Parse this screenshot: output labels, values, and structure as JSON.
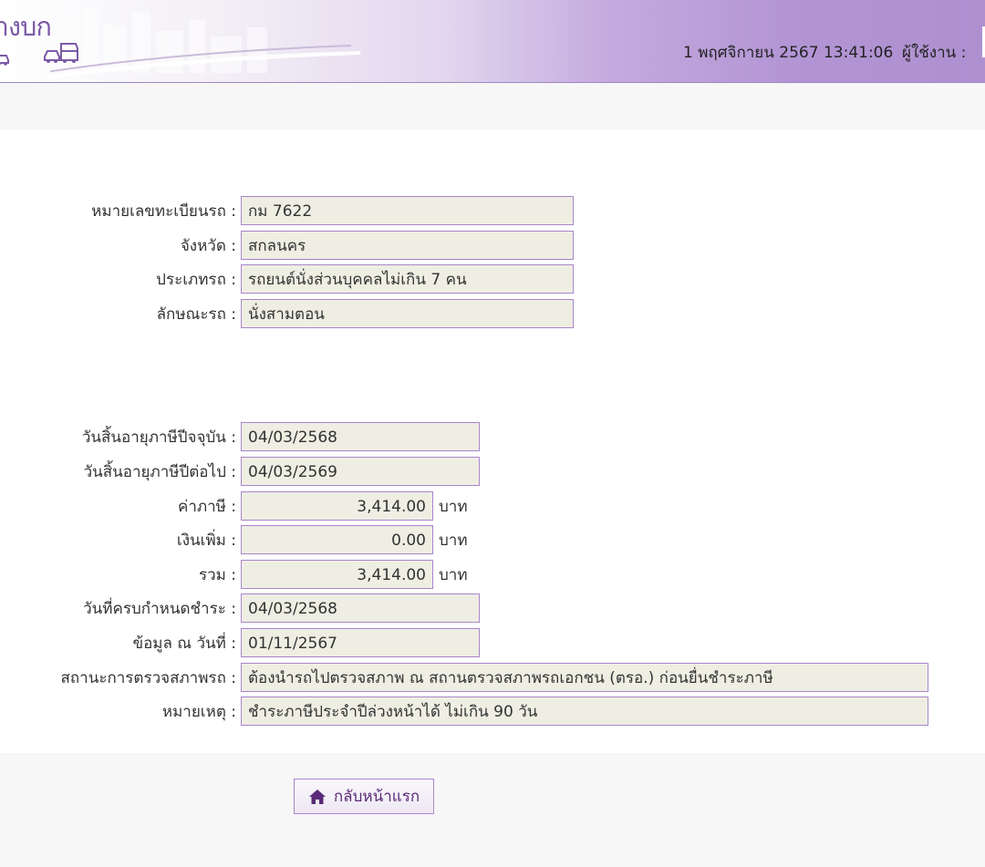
{
  "header": {
    "brand_text": "ขนส่งทางบก",
    "datetime": "1 พฤศจิกายน 2567 13:41:06",
    "user_label": "ผู้ใช้งาน :"
  },
  "vehicle": [
    {
      "label": "หมายเลขทะเบียนรถ :",
      "value": "กม 7622"
    },
    {
      "label": "จังหวัด :",
      "value": "สกลนคร"
    },
    {
      "label": "ประเภทรถ :",
      "value": "รถยนต์นั่งส่วนบุคคลไม่เกิน 7 คน"
    },
    {
      "label": "ลักษณะรถ :",
      "value": "นั่งสามตอน"
    }
  ],
  "tax": {
    "expire_current": {
      "label": "วันสิ้นอายุภาษีปีจจุบัน :",
      "value": "04/03/2568"
    },
    "expire_next": {
      "label": "วันสิ้นอายุภาษีปีต่อไป :",
      "value": "04/03/2569"
    },
    "tax_amount": {
      "label": "ค่าภาษี :",
      "value": "3,414.00",
      "unit": "บาท"
    },
    "surcharge": {
      "label": "เงินเพิ่ม :",
      "value": "0.00",
      "unit": "บาท"
    },
    "total": {
      "label": "รวม :",
      "value": "3,414.00",
      "unit": "บาท"
    },
    "due_date": {
      "label": "วันที่ครบกำหนดชำระ :",
      "value": "04/03/2568"
    },
    "data_as_of": {
      "label": "ข้อมูล ณ วันที่ :",
      "value": "01/11/2567"
    },
    "inspection_status": {
      "label": "สถานะการตรวจสภาพรถ :",
      "value": "ต้องนำรถไปตรวจสภาพ ณ สถานตรวจสภาพรถเอกชน (ตรอ.) ก่อนยื่นชำระภาษี"
    },
    "remark": {
      "label": "หมายเหตุ :",
      "value": "ชำระภาษีประจำปีล่วงหน้าได้ ไม่เกิน 90 วัน"
    }
  },
  "buttons": {
    "home_label": "กลับหน้าแรก",
    "home_icon": "home-icon"
  },
  "colors": {
    "accent": "#7b5aa6",
    "field_border": "#a985cc",
    "field_bg": "#efeee3"
  }
}
